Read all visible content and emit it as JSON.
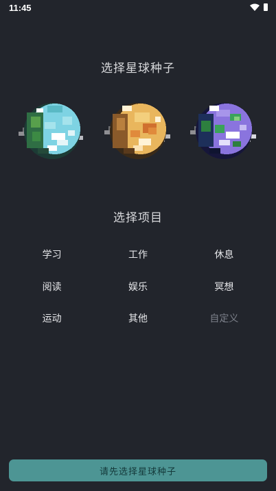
{
  "status_bar": {
    "time": "11:45",
    "icons": [
      "wifi-icon",
      "battery-icon"
    ]
  },
  "seed_section": {
    "title": "选择星球种子",
    "planets": [
      {
        "icon": "planet-ocean-icon",
        "colors": [
          "#7ed3e3",
          "#2f8f5a",
          "#ffffff"
        ]
      },
      {
        "icon": "planet-desert-icon",
        "colors": [
          "#e9b65d",
          "#d0702f",
          "#fff3d6"
        ]
      },
      {
        "icon": "planet-purple-icon",
        "colors": [
          "#8a74de",
          "#2d7f3f",
          "#ffffff"
        ]
      }
    ]
  },
  "project_section": {
    "title": "选择项目",
    "items": [
      {
        "label": "学习",
        "muted": false
      },
      {
        "label": "工作",
        "muted": false
      },
      {
        "label": "休息",
        "muted": false
      },
      {
        "label": "阅读",
        "muted": false
      },
      {
        "label": "娱乐",
        "muted": false
      },
      {
        "label": "冥想",
        "muted": false
      },
      {
        "label": "运动",
        "muted": false
      },
      {
        "label": "其他",
        "muted": false
      },
      {
        "label": "自定义",
        "muted": true
      }
    ]
  },
  "primary_button": {
    "label": "请先选择星球种子"
  },
  "colors": {
    "background": "#22252c",
    "accent": "#4d9594",
    "muted_text": "#7c808a"
  }
}
